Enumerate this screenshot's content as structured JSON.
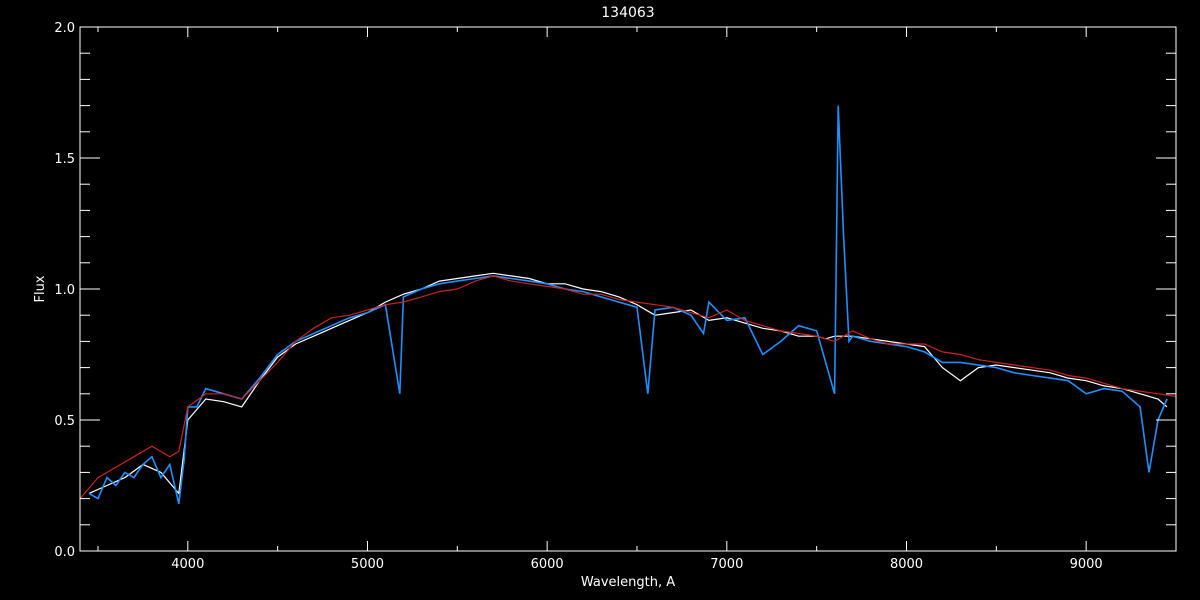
{
  "chart_data": {
    "type": "line",
    "title": "134063",
    "xlabel": "Wavelength, A",
    "ylabel": "Flux",
    "xlim": [
      3400,
      9500
    ],
    "ylim": [
      0.0,
      2.0
    ],
    "x_ticks": [
      4000,
      5000,
      6000,
      7000,
      8000,
      9000
    ],
    "x_tick_labels": [
      "4000",
      "5000",
      "6000",
      "7000",
      "8000",
      "9000"
    ],
    "y_ticks": [
      0.0,
      0.5,
      1.0,
      1.5,
      2.0
    ],
    "y_tick_labels": [
      "0.0",
      "0.5",
      "1.0",
      "1.5",
      "2.0"
    ],
    "grid": false,
    "background_color": "#000000",
    "series": [
      {
        "color": "#ffffff",
        "x": [
          3450,
          3550,
          3650,
          3750,
          3850,
          3950,
          4000,
          4100,
          4200,
          4300,
          4400,
          4500,
          4600,
          4700,
          4800,
          4900,
          5000,
          5100,
          5200,
          5300,
          5400,
          5500,
          5600,
          5700,
          5800,
          5900,
          6000,
          6100,
          6200,
          6300,
          6400,
          6500,
          6600,
          6700,
          6800,
          6900,
          7000,
          7100,
          7200,
          7300,
          7400,
          7500,
          7550,
          7600,
          7700,
          7800,
          7900,
          8000,
          8100,
          8200,
          8300,
          8400,
          8500,
          8600,
          8700,
          8800,
          8900,
          9000,
          9100,
          9200,
          9300,
          9400,
          9450
        ],
        "y": [
          0.22,
          0.25,
          0.28,
          0.33,
          0.3,
          0.22,
          0.5,
          0.58,
          0.57,
          0.55,
          0.65,
          0.74,
          0.79,
          0.82,
          0.85,
          0.88,
          0.91,
          0.95,
          0.98,
          1.0,
          1.03,
          1.04,
          1.05,
          1.06,
          1.05,
          1.04,
          1.02,
          1.02,
          1.0,
          0.99,
          0.97,
          0.94,
          0.9,
          0.91,
          0.92,
          0.88,
          0.89,
          0.87,
          0.85,
          0.84,
          0.82,
          0.82,
          0.81,
          0.82,
          0.82,
          0.81,
          0.8,
          0.79,
          0.78,
          0.7,
          0.65,
          0.7,
          0.71,
          0.7,
          0.69,
          0.68,
          0.66,
          0.65,
          0.63,
          0.62,
          0.6,
          0.58,
          0.55
        ]
      },
      {
        "color": "#1e90ff",
        "x": [
          3450,
          3500,
          3550,
          3600,
          3650,
          3700,
          3750,
          3800,
          3850,
          3900,
          3950,
          3980,
          4000,
          4050,
          4100,
          4200,
          4300,
          4400,
          4500,
          4600,
          4700,
          4800,
          4900,
          5000,
          5100,
          5180,
          5200,
          5300,
          5400,
          5500,
          5600,
          5700,
          5800,
          5900,
          6000,
          6100,
          6200,
          6300,
          6400,
          6500,
          6560,
          6600,
          6700,
          6800,
          6870,
          6900,
          7000,
          7100,
          7200,
          7300,
          7400,
          7500,
          7600,
          7620,
          7650,
          7680,
          7700,
          7800,
          7900,
          8000,
          8100,
          8200,
          8300,
          8400,
          8500,
          8600,
          8700,
          8800,
          8900,
          9000,
          9100,
          9200,
          9300,
          9350,
          9400,
          9450
        ],
        "y": [
          0.22,
          0.2,
          0.28,
          0.25,
          0.3,
          0.28,
          0.33,
          0.36,
          0.28,
          0.33,
          0.18,
          0.35,
          0.55,
          0.55,
          0.62,
          0.6,
          0.58,
          0.66,
          0.75,
          0.8,
          0.83,
          0.86,
          0.89,
          0.91,
          0.94,
          0.6,
          0.97,
          1.0,
          1.02,
          1.03,
          1.04,
          1.05,
          1.04,
          1.03,
          1.02,
          1.0,
          0.99,
          0.97,
          0.95,
          0.93,
          0.6,
          0.92,
          0.93,
          0.9,
          0.83,
          0.95,
          0.88,
          0.89,
          0.75,
          0.8,
          0.86,
          0.84,
          0.6,
          1.7,
          1.2,
          0.8,
          0.82,
          0.8,
          0.79,
          0.78,
          0.76,
          0.72,
          0.72,
          0.71,
          0.7,
          0.68,
          0.67,
          0.66,
          0.65,
          0.6,
          0.62,
          0.61,
          0.55,
          0.3,
          0.5,
          0.58
        ]
      },
      {
        "color": "#cc2222",
        "x": [
          3400,
          3500,
          3600,
          3700,
          3800,
          3900,
          3950,
          4000,
          4100,
          4200,
          4300,
          4400,
          4500,
          4600,
          4700,
          4800,
          4900,
          5000,
          5100,
          5200,
          5300,
          5400,
          5500,
          5600,
          5700,
          5800,
          5900,
          6000,
          6100,
          6200,
          6300,
          6400,
          6500,
          6600,
          6700,
          6800,
          6900,
          7000,
          7100,
          7200,
          7300,
          7400,
          7500,
          7600,
          7700,
          7800,
          7900,
          8000,
          8100,
          8200,
          8300,
          8400,
          8500,
          8600,
          8700,
          8800,
          8900,
          9000,
          9100,
          9200,
          9300,
          9400,
          9500
        ],
        "y": [
          0.2,
          0.28,
          0.32,
          0.36,
          0.4,
          0.36,
          0.38,
          0.55,
          0.6,
          0.6,
          0.58,
          0.65,
          0.72,
          0.8,
          0.85,
          0.89,
          0.9,
          0.92,
          0.94,
          0.95,
          0.97,
          0.99,
          1.0,
          1.03,
          1.05,
          1.03,
          1.02,
          1.01,
          1.0,
          0.98,
          0.98,
          0.96,
          0.95,
          0.94,
          0.93,
          0.91,
          0.89,
          0.92,
          0.88,
          0.86,
          0.84,
          0.83,
          0.82,
          0.8,
          0.84,
          0.81,
          0.79,
          0.79,
          0.79,
          0.76,
          0.75,
          0.73,
          0.72,
          0.71,
          0.7,
          0.69,
          0.67,
          0.66,
          0.64,
          0.62,
          0.61,
          0.6,
          0.59
        ]
      }
    ]
  }
}
